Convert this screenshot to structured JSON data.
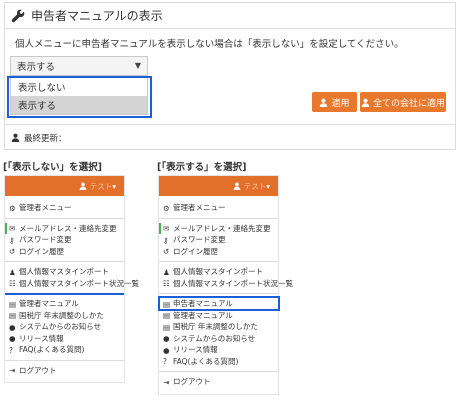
{
  "panel": {
    "title": "申告者マニュアルの表示",
    "description": "個人メニューに申告者マニュアルを表示しない場合は「表示しない」を設定してください。",
    "select_value": "表示する",
    "dropdown_options": [
      "表示しない",
      "表示する"
    ],
    "apply_label": "適用",
    "apply_all_label": "全ての会社に適用",
    "last_updated_label": "最終更新："
  },
  "captions": {
    "left": "[「表示しない」を選択]",
    "right": "[「表示する」を選択]"
  },
  "menu_left": {
    "user_name": "テスト",
    "items": [
      "管理者メニュー",
      "メールアドレス・連絡先変更",
      "パスワード変更",
      "ログイン履歴",
      "個人情報マスタインポート",
      "個人情報マスタインポート状況一覧",
      "管理者マニュアル",
      "国税庁 年末調整のしかた",
      "システムからのお知らせ",
      "リリース情報",
      "FAQ(よくある質問)",
      "ログアウト"
    ]
  },
  "menu_right": {
    "user_name": "テスト",
    "items": [
      "管理者メニュー",
      "メールアドレス・連絡先変更",
      "パスワード変更",
      "ログイン履歴",
      "個人情報マスタインポート",
      "個人情報マスタインポート状況一覧",
      "申告者マニュアル",
      "管理者マニュアル",
      "国税庁 年末調整のしかた",
      "システムからのお知らせ",
      "リリース情報",
      "FAQ(よくある質問)",
      "ログアウト"
    ]
  },
  "colors": {
    "accent": "#e8782c",
    "menu_bar": "#e26f2a",
    "highlight": "#1a5fd6"
  }
}
